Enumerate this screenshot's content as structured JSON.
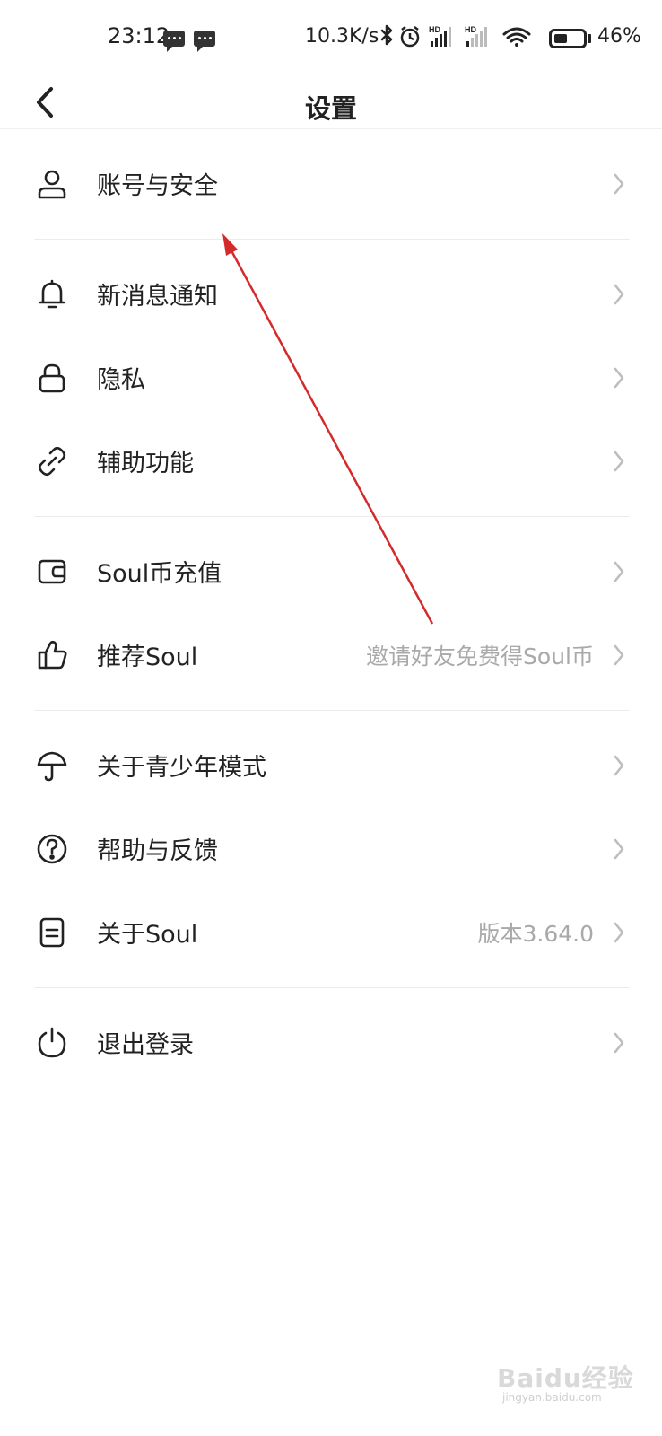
{
  "status_bar": {
    "time": "23:12",
    "net_speed": "10.3K/s",
    "battery_percent": "46%",
    "battery_level": 0.46,
    "icons": [
      "message-icon",
      "message-icon",
      "bluetooth-icon",
      "alarm-icon",
      "signal-hd-icon",
      "signal-hd-icon",
      "wifi-icon",
      "battery-icon"
    ]
  },
  "header": {
    "title": "设置",
    "back_icon": "chevron-left-icon"
  },
  "settings": {
    "groups": [
      {
        "items": [
          {
            "label": "账号与安全",
            "value": "",
            "icon": "user-icon"
          }
        ]
      },
      {
        "items": [
          {
            "label": "新消息通知",
            "value": "",
            "icon": "bell-icon"
          },
          {
            "label": "隐私",
            "value": "",
            "icon": "lock-icon"
          },
          {
            "label": "辅助功能",
            "value": "",
            "icon": "link-icon"
          }
        ]
      },
      {
        "items": [
          {
            "label": "Soul币充值",
            "value": "",
            "icon": "wallet-icon"
          },
          {
            "label": "推荐Soul",
            "value": "邀请好友免费得Soul币",
            "icon": "thumbs-up-icon"
          }
        ]
      },
      {
        "items": [
          {
            "label": "关于青少年模式",
            "value": "",
            "icon": "umbrella-icon"
          },
          {
            "label": "帮助与反馈",
            "value": "",
            "icon": "help-circle-icon"
          },
          {
            "label": "关于Soul",
            "value": "版本3.64.0",
            "icon": "document-icon"
          }
        ]
      },
      {
        "items": [
          {
            "label": "退出登录",
            "value": "",
            "icon": "power-icon"
          }
        ]
      }
    ]
  },
  "annotation": {
    "color": "#d42a2a",
    "target": "账号与安全"
  },
  "watermark": {
    "text": "Baidu经验",
    "sub": "jingyan.baidu.com"
  }
}
